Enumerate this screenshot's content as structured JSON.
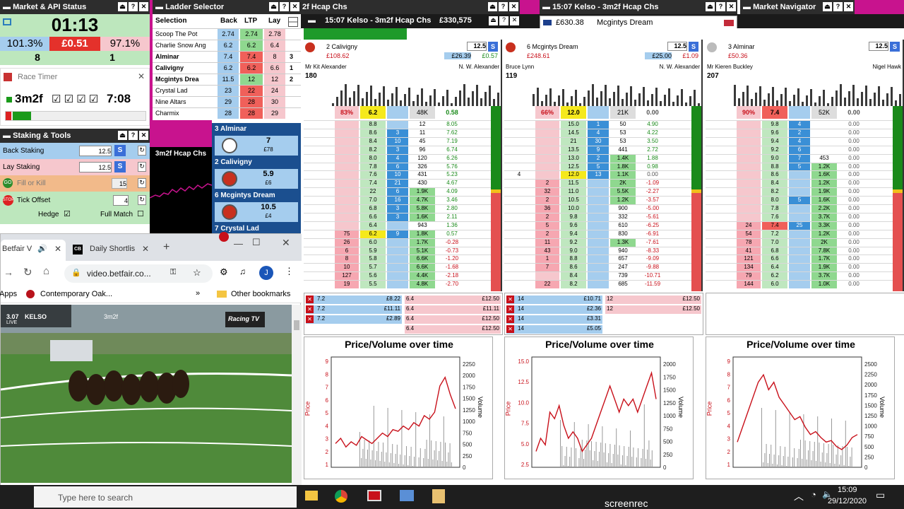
{
  "market_status": {
    "title": "Market & API Status",
    "timer": "01:13",
    "back_pct": "101.3%",
    "lay_pct": "97.1%",
    "pl": "£0.51",
    "back_count": "8",
    "lay_count": "1"
  },
  "race_timer": {
    "title": "Race Timer",
    "distance": "3m2f",
    "time": "7:08"
  },
  "staking": {
    "title": "Staking & Tools",
    "back_label": "Back Staking",
    "back_value": "12.5",
    "lay_label": "Lay Staking",
    "lay_value": "12.5",
    "fok_label": "Fill or Kill",
    "fok_value": "15",
    "tick_label": "Tick Offset",
    "tick_value": "4",
    "hedge_label": "Hedge",
    "fullmatch_label": "Full Match",
    "s_label": "S"
  },
  "ladder_selector": {
    "title": "Ladder Selector",
    "headers": [
      "Selection",
      "Back",
      "LTP",
      "Lay"
    ],
    "rows": [
      {
        "name": "Scoop The Pot",
        "back": "2.74",
        "ltp": "2.74",
        "lay": "2.78",
        "n": ""
      },
      {
        "name": "Charlie Snow Ang",
        "back": "6.2",
        "ltp": "6.2",
        "lay": "6.4",
        "n": ""
      },
      {
        "name": "Alminar",
        "back": "7.4",
        "ltp": "7.4",
        "lay": "8",
        "n": "3"
      },
      {
        "name": "Calivigny",
        "back": "6.2",
        "ltp": "6.2",
        "lay": "6.6",
        "n": "1"
      },
      {
        "name": "Mcgintys Drea",
        "back": "11.5",
        "ltp": "12",
        "lay": "12",
        "n": "2"
      },
      {
        "name": "Crystal Lad",
        "back": "23",
        "ltp": "22",
        "lay": "24",
        "n": ""
      },
      {
        "name": "Nine Altars",
        "back": "29",
        "ltp": "28",
        "lay": "30",
        "n": ""
      },
      {
        "name": "Charmix",
        "back": "28",
        "ltp": "28",
        "lay": "29",
        "n": ""
      }
    ]
  },
  "mini_chart": {
    "title": "3m2f Hcap Chs"
  },
  "runner_list": [
    {
      "name": "3 Alminar",
      "price": "7",
      "amount": "£78"
    },
    {
      "name": "2 Calivigny",
      "price": "5.9",
      "amount": "£6"
    },
    {
      "name": "6 Mcgintys Dream",
      "price": "10.5",
      "amount": "£4"
    },
    {
      "name": "7 Crystal Lad",
      "price": "",
      "amount": ""
    }
  ],
  "ladder_window": {
    "title_left": "2f Hcap Chs",
    "title": "15:07 Kelso - 3m2f Hcap Chs",
    "matched": "£330,575"
  },
  "ladder_window2": {
    "title": "15:07 Kelso - 3m2f Hcap Chs",
    "amount": "£630.38",
    "runner": "Mcgintys Dream"
  },
  "market_navigator": {
    "title": "Market Navigator"
  },
  "ladders": [
    {
      "runner": "2 Calivigny",
      "pl": "£108.62",
      "stake": "12.5",
      "s": "S",
      "profit_a": "£26.39",
      "profit_b": "£0.57",
      "jockey": "Mr Kit Alexander",
      "trainer": "N. W. Alexander",
      "vol": "180",
      "book": "83%",
      "ltp": "6.2",
      "matched": "48K",
      "pl2": "0.58",
      "rows": [
        [
          "",
          "",
          "8.8",
          "",
          "12",
          "8.05"
        ],
        [
          "",
          "",
          "8.6",
          "3",
          "11",
          "7.62"
        ],
        [
          "",
          "",
          "8.4",
          "10",
          "45",
          "7.19"
        ],
        [
          "",
          "",
          "8.2",
          "3",
          "96",
          "6.74"
        ],
        [
          "",
          "",
          "8.0",
          "4",
          "120",
          "6.26"
        ],
        [
          "",
          "",
          "7.8",
          "6",
          "326",
          "5.76"
        ],
        [
          "",
          "",
          "7.6",
          "10",
          "431",
          "5.23"
        ],
        [
          "",
          "",
          "7.4",
          "21",
          "430",
          "4.67"
        ],
        [
          "",
          "",
          "22",
          "6",
          "1.9K",
          "4.09"
        ],
        [
          "",
          "",
          "7.0",
          "16",
          "4.7K",
          "3.46"
        ],
        [
          "",
          "",
          "6.8",
          "3",
          "5.8K",
          "2.80"
        ],
        [
          "",
          "",
          "6.6",
          "3",
          "1.6K",
          "2.11"
        ],
        [
          "",
          "",
          "6.4",
          "",
          "943",
          "1.36"
        ],
        [
          "",
          "75",
          "6.2",
          "9",
          "1.8K",
          "0.57"
        ],
        [
          "",
          "26",
          "6.0",
          "",
          "1.7K",
          "-0.28"
        ],
        [
          "",
          "6",
          "5.9",
          "",
          "5.1K",
          "-0.73"
        ],
        [
          "",
          "8",
          "5.8",
          "",
          "6.6K",
          "-1.20"
        ],
        [
          "",
          "10",
          "5.7",
          "",
          "6.6K",
          "-1.68"
        ],
        [
          "",
          "127",
          "5.6",
          "",
          "4.4K",
          "-2.18"
        ],
        [
          "",
          "19",
          "5.5",
          "",
          "4.8K",
          "-2.70"
        ]
      ]
    },
    {
      "runner": "6 Mcgintys Dream",
      "pl": "£248.61",
      "stake": "12.5",
      "s": "S",
      "profit_a": "£25.00",
      "profit_b": "£1.09",
      "jockey": "Bruce Lynn",
      "trainer": "N. W. Alexander",
      "vol": "119",
      "book": "66%",
      "ltp": "12.0",
      "matched": "21K",
      "pl2": "0.00",
      "rows": [
        [
          "",
          "",
          "15.0",
          "1",
          "50",
          "4.90"
        ],
        [
          "",
          "",
          "14.5",
          "4",
          "53",
          "4.22"
        ],
        [
          "",
          "",
          "21",
          "30",
          "53",
          "3.50"
        ],
        [
          "",
          "",
          "13.5",
          "9",
          "441",
          "2.72"
        ],
        [
          "",
          "",
          "13.0",
          "2",
          "1.4K",
          "1.88"
        ],
        [
          "",
          "",
          "12.5",
          "5",
          "1.8K",
          "0.98"
        ],
        [
          "4",
          "",
          "12.0",
          "13",
          "1.1K",
          "0.00"
        ],
        [
          "",
          "2",
          "11.5",
          "",
          "2K",
          "-1.09"
        ],
        [
          "",
          "32",
          "11.0",
          "",
          "5.5K",
          "-2.27"
        ],
        [
          "",
          "2",
          "10.5",
          "",
          "1.2K",
          "-3.57"
        ],
        [
          "",
          "36",
          "10.0",
          "",
          "900",
          "-5.00"
        ],
        [
          "",
          "2",
          "9.8",
          "",
          "332",
          "-5.61"
        ],
        [
          "",
          "5",
          "9.6",
          "",
          "610",
          "-6.25"
        ],
        [
          "",
          "2",
          "9.4",
          "",
          "830",
          "-6.91"
        ],
        [
          "",
          "11",
          "9.2",
          "",
          "1.3K",
          "-7.61"
        ],
        [
          "",
          "43",
          "9.0",
          "",
          "940",
          "-8.33"
        ],
        [
          "",
          "1",
          "8.8",
          "",
          "657",
          "-9.09"
        ],
        [
          "",
          "7",
          "8.6",
          "",
          "247",
          "-9.88"
        ],
        [
          "",
          "",
          "8.4",
          "",
          "739",
          "-10.71"
        ],
        [
          "",
          "22",
          "8.2",
          "",
          "685",
          "-11.59"
        ]
      ]
    },
    {
      "runner": "3 Alminar",
      "pl": "£50.36",
      "stake": "12.5",
      "s": "S",
      "profit_a": "",
      "profit_b": "",
      "jockey": "Mr Kieren Buckley",
      "trainer": "Nigel Hawk",
      "vol": "207",
      "book": "90%",
      "ltp": "7.4",
      "matched": "52K",
      "pl2": "0.00",
      "rows": [
        [
          "",
          "",
          "9.8",
          "4",
          "",
          "0.00"
        ],
        [
          "",
          "",
          "9.6",
          "2",
          "",
          "0.00"
        ],
        [
          "",
          "",
          "9.4",
          "4",
          "",
          "0.00"
        ],
        [
          "",
          "",
          "9.2",
          "6",
          "",
          "0.00"
        ],
        [
          "",
          "",
          "9.0",
          "7",
          "453",
          "0.00"
        ],
        [
          "",
          "",
          "8.8",
          "5",
          "1.2K",
          "0.00"
        ],
        [
          "",
          "",
          "8.6",
          "",
          "1.6K",
          "0.00"
        ],
        [
          "",
          "",
          "8.4",
          "",
          "1.2K",
          "0.00"
        ],
        [
          "",
          "",
          "8.2",
          "",
          "1.9K",
          "0.00"
        ],
        [
          "",
          "",
          "8.0",
          "5",
          "1.6K",
          "0.00"
        ],
        [
          "",
          "",
          "7.8",
          "",
          "2.2K",
          "0.00"
        ],
        [
          "",
          "",
          "7.6",
          "",
          "3.7K",
          "0.00"
        ],
        [
          "",
          "24",
          "7.4",
          "25",
          "3.3K",
          "0.00"
        ],
        [
          "",
          "54",
          "7.2",
          "",
          "1.2K",
          "0.00"
        ],
        [
          "",
          "78",
          "7.0",
          "",
          "2K",
          "0.00"
        ],
        [
          "",
          "41",
          "6.8",
          "",
          "7.8K",
          "0.00"
        ],
        [
          "",
          "121",
          "6.6",
          "",
          "1.7K",
          "0.00"
        ],
        [
          "",
          "134",
          "6.4",
          "",
          "1.9K",
          "0.00"
        ],
        [
          "",
          "79",
          "6.2",
          "",
          "3.7K",
          "0.00"
        ],
        [
          "",
          "144",
          "6.0",
          "",
          "1.0K",
          "0.00"
        ]
      ]
    }
  ],
  "orders": [
    {
      "left": [
        [
          "7.2",
          "£8.22"
        ],
        [
          "7.2",
          "£11.11"
        ],
        [
          "7.2",
          "£2.89"
        ]
      ],
      "right": [
        [
          "6.4",
          "£12.50"
        ],
        [
          "6.4",
          "£11.11"
        ],
        [
          "6.4",
          "£12.50"
        ],
        [
          "6.4",
          "£12.50"
        ]
      ]
    },
    {
      "left": [
        [
          "14",
          "£10.71"
        ],
        [
          "14",
          "£2.36"
        ],
        [
          "14",
          "£3.31"
        ],
        [
          "14",
          "£5.05"
        ]
      ],
      "right": [
        [
          "12",
          "£12.50"
        ],
        [
          "12",
          "£12.50"
        ]
      ]
    },
    {
      "left": [],
      "right": []
    }
  ],
  "chart_data": [
    {
      "type": "line",
      "title": "Price/Volume over time",
      "ylabel": "Price",
      "y2label": "Volume",
      "yticks": [
        "1",
        "2",
        "3",
        "4",
        "5",
        "6",
        "7",
        "8",
        "9"
      ],
      "y2ticks": [
        "0",
        "250",
        "500",
        "750",
        "1000",
        "1250",
        "1500",
        "1750",
        "2000",
        "2250"
      ],
      "price_series": [
        5.2,
        5.5,
        5.0,
        5.3,
        5.1,
        5.6,
        5.4,
        5.2,
        5.5,
        5.8,
        5.6,
        6.0,
        5.9,
        6.2,
        6.0,
        6.4,
        6.2,
        6.8,
        6.6,
        7.0,
        8.5,
        9.0,
        8.0,
        7.2
      ]
    },
    {
      "type": "line",
      "title": "Price/Volume over time",
      "ylabel": "Price",
      "y2label": "Volume",
      "yticks": [
        "2.5",
        "5.0",
        "7.5",
        "10.0",
        "12.5",
        "15.0"
      ],
      "y2ticks": [
        "0",
        "250",
        "500",
        "750",
        "1000",
        "1250",
        "1500",
        "1750",
        "2000"
      ],
      "price_series": [
        8,
        9,
        8.5,
        11,
        10.5,
        11.5,
        10,
        9,
        9.5,
        9,
        8,
        8.5,
        9,
        10,
        11,
        12,
        13,
        12,
        11,
        12,
        11.5,
        12,
        11,
        12,
        13,
        14,
        12
      ]
    },
    {
      "type": "line",
      "title": "Price/Volume over time",
      "ylabel": "Price",
      "y2label": "Volume",
      "yticks": [
        "1",
        "2",
        "3",
        "4",
        "5",
        "6",
        "7",
        "8",
        "9"
      ],
      "y2ticks": [
        "0",
        "250",
        "500",
        "750",
        "1000",
        "1250",
        "1500",
        "1750",
        "2000",
        "2250",
        "2500"
      ],
      "price_series": [
        4.5,
        5.5,
        6.5,
        7.5,
        8.5,
        9.0,
        8.0,
        8.5,
        7.5,
        7.0,
        6.5,
        6.0,
        6.2,
        5.5,
        5.0,
        5.2,
        4.8,
        4.5,
        4.6,
        4.2,
        4.0,
        4.3,
        4.8,
        5.0
      ]
    }
  ],
  "browser": {
    "tab1": "Betfair V",
    "tab2": "Daily Shortlis",
    "url": "video.betfair.co...",
    "avatar": "J",
    "bookmark1": "Contemporary Oak...",
    "bookmark_more": "Other bookmarks",
    "apps": "Apps"
  },
  "video": {
    "score": "3.07",
    "course": "KELSO",
    "dist": "3m2f",
    "live": "LIVE",
    "channel": "Racing TV"
  },
  "taskbar": {
    "search": "Type here to search",
    "time": "15:09",
    "date": "29/12/2020",
    "rec": "screenrec"
  }
}
